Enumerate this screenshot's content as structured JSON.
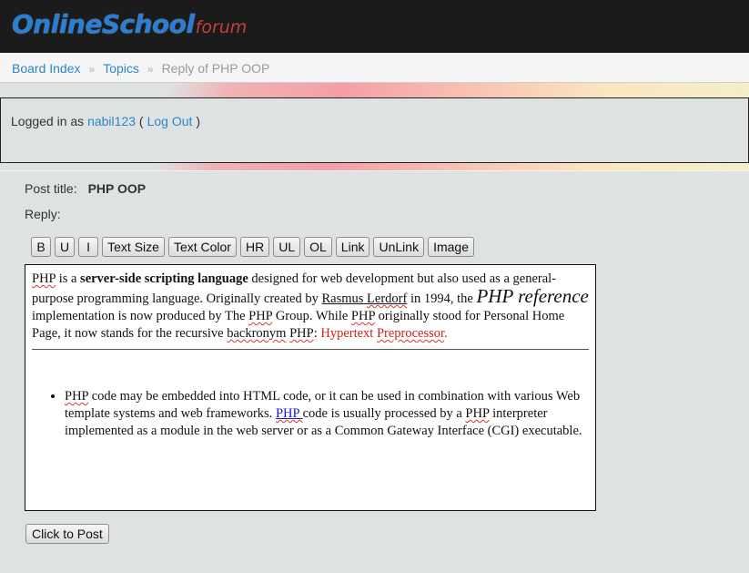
{
  "logo": {
    "main": "OnlineSchool",
    "sub": "forum"
  },
  "breadcrumb": {
    "board_index": "Board Index",
    "sep": "»",
    "topics": "Topics",
    "current": "Reply of PHP OOP"
  },
  "login": {
    "prefix": "Logged in as",
    "username": "nabil123",
    "open": "(",
    "logout": "Log Out",
    "close": ")"
  },
  "post": {
    "title_label": "Post title:",
    "title_value": "PHP OOP",
    "reply_label": "Reply:"
  },
  "toolbar": {
    "bold": "B",
    "underline": "U",
    "italic": "I",
    "text_size": "Text Size",
    "text_color": "Text Color",
    "hr": "HR",
    "ul": "UL",
    "ol": "OL",
    "link": "Link",
    "unlink": "UnLink",
    "image": "Image"
  },
  "editor": {
    "p_php": "PHP",
    "p_is_a": " is a ",
    "p_bold": "server-side scripting language",
    "p_t1": " designed for web development but also used as a general-purpose programming language. Originally created by ",
    "p_rasmus": "Rasmus",
    "p_sp1": " ",
    "p_lerdorf": "Lerdorf",
    "p_t2": " in 1994, the ",
    "p_big": "PHP reference",
    "p_t3": " implementation is now produced by The ",
    "p_php2": "PHP",
    "p_t4": " Group. While ",
    "p_php3": "PHP",
    "p_t5": " originally stood for Personal Home Page, it now stands for the recursive ",
    "p_backronym": "backronym",
    "p_sp2": " ",
    "p_php4": "PHP",
    "p_t6": ": ",
    "p_red1": "Hypertext ",
    "p_red2": "Preprocessor",
    "p_red3": ".",
    "li_php": "PHP",
    "li_t1": " code may be embedded into HTML code, or it can be used in combination with various Web template systems and web frameworks. ",
    "li_php_link": "PHP ",
    "li_t2": "code is usually processed by a ",
    "li_php2": "PHP",
    "li_t3": " interpreter implemented as a module in the web server or as a Common Gateway Interface (CGI) executable."
  },
  "submit": {
    "label": "Click to Post"
  }
}
